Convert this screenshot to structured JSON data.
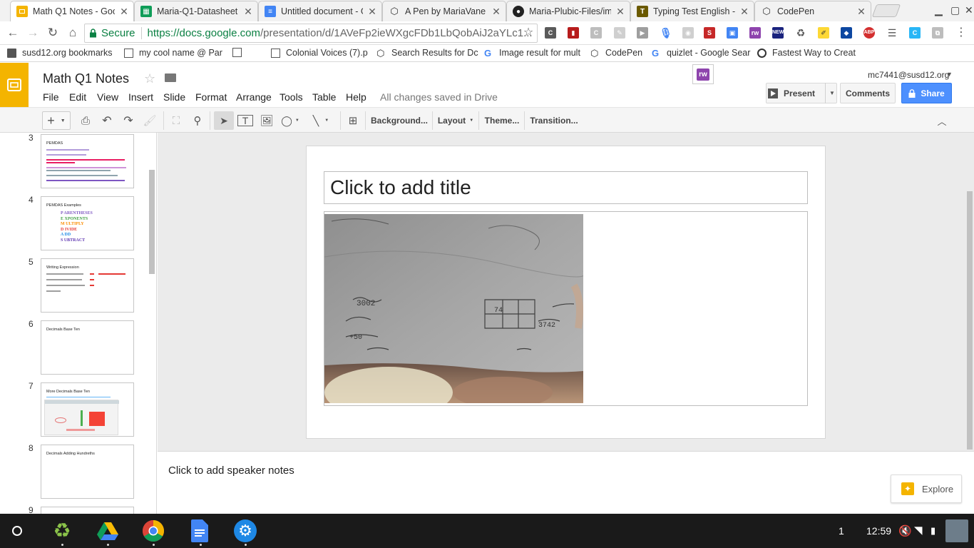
{
  "browser": {
    "tabs": [
      {
        "title": "Math Q1 Notes - Goo",
        "favicon_color": "#f4b400",
        "active": true
      },
      {
        "title": "Maria-Q1-Datasheet",
        "favicon_color": "#0f9d58"
      },
      {
        "title": "Untitled document - G",
        "favicon_color": "#4285f4"
      },
      {
        "title": "A Pen by MariaVane",
        "favicon_color": "#333333"
      },
      {
        "title": "Maria-Plubic-Files/im",
        "favicon_color": "#222222"
      },
      {
        "title": "Typing Test English -",
        "favicon_color": "#6b5a00"
      },
      {
        "title": "CodePen",
        "favicon_color": "#333333"
      }
    ],
    "address": {
      "secure_label": "Secure",
      "url_host": "https://docs.google.com",
      "url_path": "/presentation/d/1AVeFp2ieWXgcFDb1LbQobAiJ2aYLc1..."
    },
    "bookmarks": [
      {
        "label": "susd12.org bookmarks",
        "icon": "folder-icon"
      },
      {
        "label": "my cool name @ Par",
        "icon": "page-icon"
      },
      {
        "label": "",
        "icon": "page-icon"
      },
      {
        "label": "Colonial Voices (7).p",
        "icon": "page-icon"
      },
      {
        "label": "Search Results for Dc",
        "icon": "codepen-icon"
      },
      {
        "label": "Image result for mult",
        "icon": "google-icon"
      },
      {
        "label": "CodePen",
        "icon": "codepen-icon"
      },
      {
        "label": "quizlet - Google Sear",
        "icon": "google-icon"
      },
      {
        "label": "Fastest Way to Creat",
        "icon": "site-icon"
      }
    ],
    "extension_badge": "rw"
  },
  "docs": {
    "title": "Math Q1 Notes",
    "menus": [
      "File",
      "Edit",
      "View",
      "Insert",
      "Slide",
      "Format",
      "Arrange",
      "Tools",
      "Table",
      "Help"
    ],
    "saved_status": "All changes saved in Drive",
    "account": "mc7441@susd12.org",
    "present_label": "Present",
    "comments_label": "Comments",
    "share_label": "Share",
    "toolbar": {
      "background_label": "Background...",
      "layout_label": "Layout",
      "theme_label": "Theme...",
      "transition_label": "Transition..."
    }
  },
  "filmstrip": {
    "slides": [
      {
        "num": "3",
        "title": "PEMDAS"
      },
      {
        "num": "4",
        "title": "PEMDAS Examples",
        "acronym": [
          "P ARENTHESES",
          "E XPONENTS",
          "M ULTIPLY",
          "D IVIDE",
          "A DD",
          "S UBTRACT"
        ]
      },
      {
        "num": "5",
        "title": "Writing Expression"
      },
      {
        "num": "6",
        "title": "Decimals Base Ten"
      },
      {
        "num": "7",
        "title": "More Decimals Base Ten"
      },
      {
        "num": "8",
        "title": "Decimals Adding Hundreths"
      },
      {
        "num": "9",
        "title": ""
      }
    ]
  },
  "slide": {
    "title_placeholder": "Click to add title"
  },
  "notes": {
    "placeholder": "Click to add speaker notes"
  },
  "explore_label": "Explore",
  "shelf": {
    "notification_count": "1",
    "time": "12:59"
  }
}
